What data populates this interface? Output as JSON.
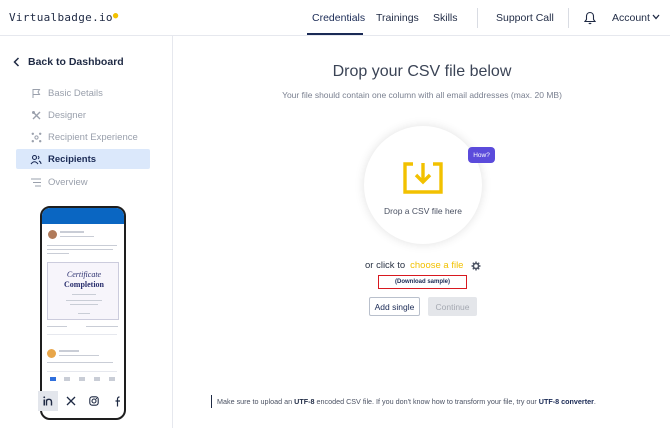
{
  "brand": {
    "logo_text": "Virtualbadge.io",
    "accent": "#f2c100",
    "primary": "#1a2a55"
  },
  "nav": {
    "credentials": "Credentials",
    "trainings": "Trainings",
    "skills": "Skills",
    "support": "Support Call",
    "account": "Account"
  },
  "sidebar": {
    "back": "Back to Dashboard",
    "items": [
      {
        "label": "Basic Details",
        "icon": "flag-icon",
        "active": false
      },
      {
        "label": "Designer",
        "icon": "tools-icon",
        "active": false
      },
      {
        "label": "Recipient Experience",
        "icon": "hub-icon",
        "active": false
      },
      {
        "label": "Recipients",
        "icon": "users-icon",
        "active": true
      },
      {
        "label": "Overview",
        "icon": "list-icon",
        "active": false
      }
    ],
    "preview": {
      "cert_line1": "Certificate",
      "cert_line2": "Completion"
    },
    "social": [
      "linkedin-icon",
      "x-icon",
      "instagram-icon",
      "facebook-icon"
    ]
  },
  "main": {
    "title": "Drop your CSV file below",
    "subtitle": "Your file should contain one column with all email addresses (max. 20 MB)",
    "drop_text": "Drop a CSV file here",
    "how": "How?",
    "or_click": "or click to",
    "choose_file": "choose a file",
    "download_sample": "(Download sample)",
    "add_single": "Add single",
    "continue": "Continue",
    "footer": {
      "prefix": "Make sure to upload an",
      "utf8": "UTF-8",
      "middle": "encoded CSV file. If you don't know how to transform your file, try our",
      "converter": "UTF-8 converter",
      "suffix": "."
    }
  }
}
